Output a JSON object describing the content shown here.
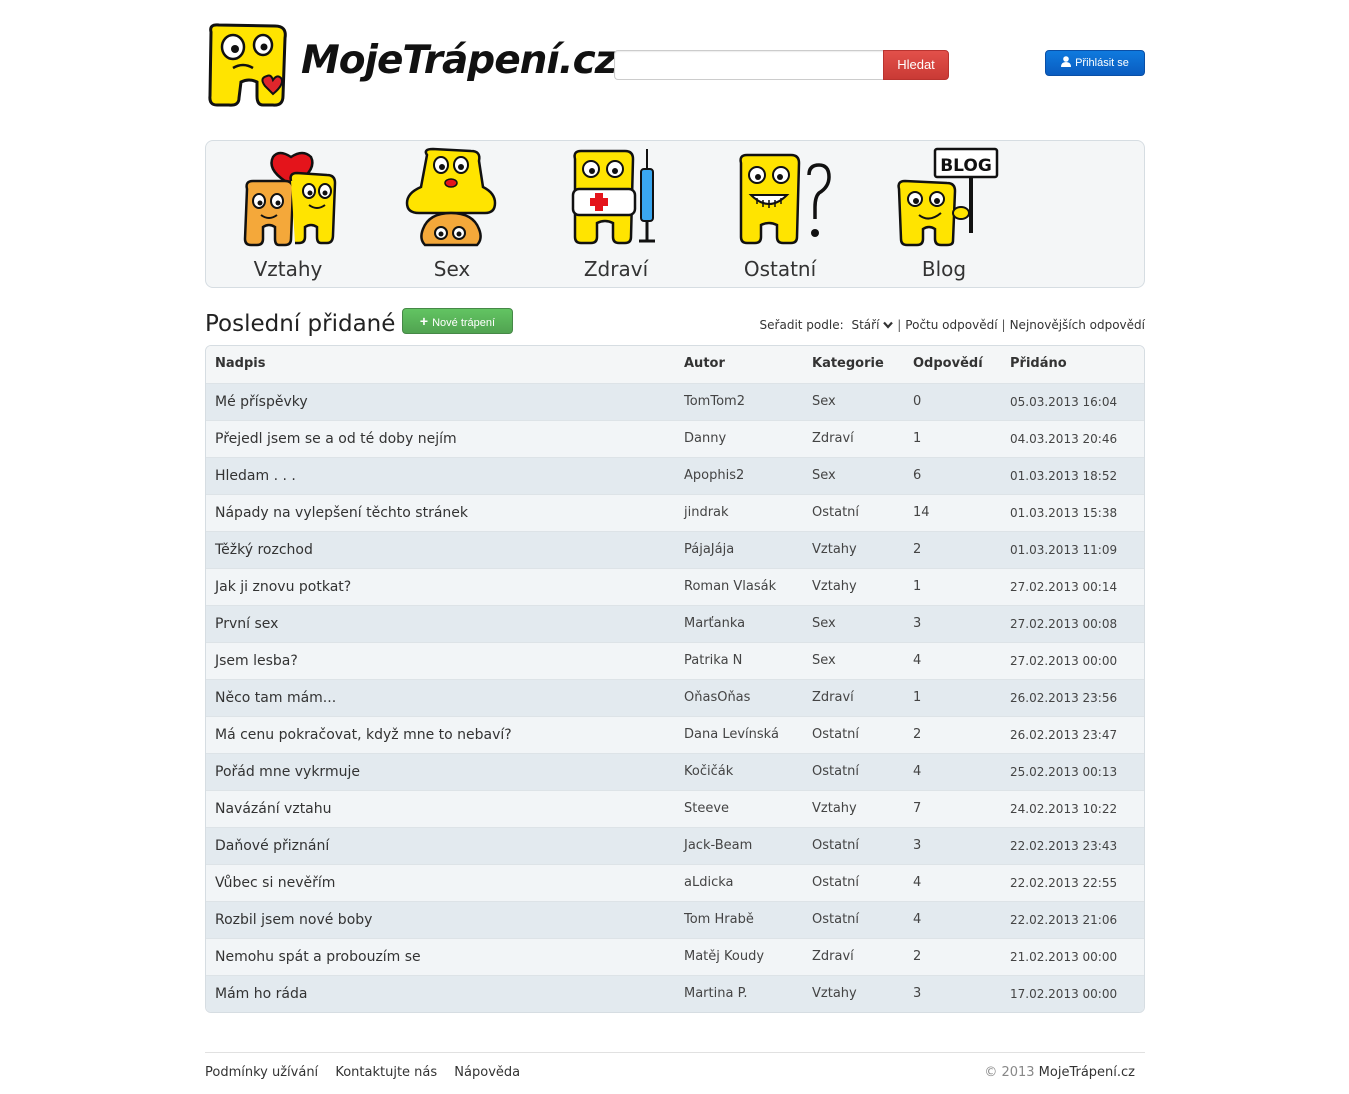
{
  "header": {
    "logo_text": "MojeTrápení.cz",
    "search_placeholder": "",
    "search_button": "Hledat",
    "login_button": "Přihlásit se"
  },
  "categories": [
    {
      "label": "Vztahy",
      "icon": "relationship-icon"
    },
    {
      "label": "Sex",
      "icon": "sex-icon"
    },
    {
      "label": "Zdraví",
      "icon": "health-icon"
    },
    {
      "label": "Ostatní",
      "icon": "other-icon"
    },
    {
      "label": "Blog",
      "icon": "blog-icon"
    }
  ],
  "section": {
    "title": "Poslední přidané",
    "new_button": "Nové trápení"
  },
  "sort": {
    "label": "Seřadit podle:",
    "options": [
      "Stáří",
      "Počtu odpovědí",
      "Nejnovějších odpovědí"
    ]
  },
  "table": {
    "columns": [
      "Nadpis",
      "Autor",
      "Kategorie",
      "Odpovědí",
      "Přidáno"
    ],
    "rows": [
      {
        "title": "Mé příspěvky",
        "author": "TomTom2",
        "category": "Sex",
        "answers": "0",
        "date": "05.03.2013 16:04"
      },
      {
        "title": "Přejedl jsem se a od té doby nejím",
        "author": "Danny",
        "category": "Zdraví",
        "answers": "1",
        "date": "04.03.2013 20:46"
      },
      {
        "title": "Hledam . . .",
        "author": "Apophis2",
        "category": "Sex",
        "answers": "6",
        "date": "01.03.2013 18:52"
      },
      {
        "title": "Nápady na vylepšení těchto stránek",
        "author": "jindrak",
        "category": "Ostatní",
        "answers": "14",
        "date": "01.03.2013 15:38"
      },
      {
        "title": "Těžký rozchod",
        "author": "PájaJája",
        "category": "Vztahy",
        "answers": "2",
        "date": "01.03.2013 11:09"
      },
      {
        "title": "Jak ji znovu potkat?",
        "author": "Roman Vlasák",
        "category": "Vztahy",
        "answers": "1",
        "date": "27.02.2013 00:14"
      },
      {
        "title": "První sex",
        "author": "Marťanka",
        "category": "Sex",
        "answers": "3",
        "date": "27.02.2013 00:08"
      },
      {
        "title": "Jsem lesba?",
        "author": "Patrika N",
        "category": "Sex",
        "answers": "4",
        "date": "27.02.2013 00:00"
      },
      {
        "title": "Něco tam mám...",
        "author": "OňasOňas",
        "category": "Zdraví",
        "answers": "1",
        "date": "26.02.2013 23:56"
      },
      {
        "title": "Má cenu pokračovat, když mne to nebaví?",
        "author": "Dana Levínská",
        "category": "Ostatní",
        "answers": "2",
        "date": "26.02.2013 23:47"
      },
      {
        "title": "Pořád mne vykrmuje",
        "author": "Kočičák",
        "category": "Ostatní",
        "answers": "4",
        "date": "25.02.2013 00:13"
      },
      {
        "title": "Navázání vztahu",
        "author": "Steeve",
        "category": "Vztahy",
        "answers": "7",
        "date": "24.02.2013 10:22"
      },
      {
        "title": "Daňové přiznání",
        "author": "Jack-Beam",
        "category": "Ostatní",
        "answers": "3",
        "date": "22.02.2013 23:43"
      },
      {
        "title": "Vůbec si nevěřím",
        "author": "aLdicka",
        "category": "Ostatní",
        "answers": "4",
        "date": "22.02.2013 22:55"
      },
      {
        "title": "Rozbil jsem nové boby",
        "author": "Tom Hrabě",
        "category": "Ostatní",
        "answers": "4",
        "date": "22.02.2013 21:06"
      },
      {
        "title": "Nemohu spát a probouzím se",
        "author": "Matěj Koudy",
        "category": "Zdraví",
        "answers": "2",
        "date": "21.02.2013 00:00"
      },
      {
        "title": "Mám ho ráda",
        "author": "Martina P.",
        "category": "Vztahy",
        "answers": "3",
        "date": "17.02.2013 00:00"
      }
    ]
  },
  "footer": {
    "links": [
      "Podmínky užívání",
      "Kontaktujte nás",
      "Nápověda"
    ],
    "copyright_prefix": "© 2013",
    "copyright_site": "MojeTrápení.cz"
  },
  "colors": {
    "search_button": "#d9443e",
    "login_button": "#0b66cf",
    "new_button": "#57b057",
    "mascot_yellow": "#ffe400"
  }
}
